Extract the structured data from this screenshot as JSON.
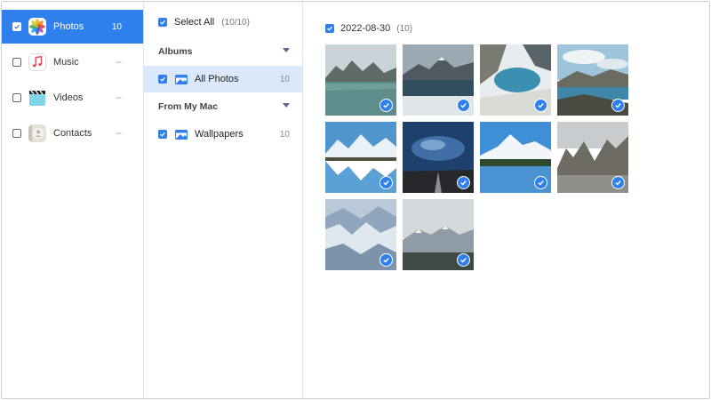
{
  "sidebar": {
    "items": [
      {
        "label": "Photos",
        "count": "10",
        "icon": "photos-app-icon",
        "checked": true,
        "active": true
      },
      {
        "label": "Music",
        "count": "--",
        "icon": "music-app-icon",
        "checked": false,
        "active": false
      },
      {
        "label": "Videos",
        "count": "--",
        "icon": "videos-app-icon",
        "checked": false,
        "active": false
      },
      {
        "label": "Contacts",
        "count": "--",
        "icon": "contacts-app-icon",
        "checked": false,
        "active": false
      }
    ]
  },
  "albums_panel": {
    "select_all": {
      "label": "Select All",
      "count": "(10/10)",
      "checked": true
    },
    "sections": [
      {
        "title": "Albums",
        "items": [
          {
            "label": "All Photos",
            "count": "10",
            "checked": true,
            "active": true
          }
        ]
      },
      {
        "title": "From My Mac",
        "items": [
          {
            "label": "Wallpapers",
            "count": "10",
            "checked": true,
            "active": false
          }
        ]
      }
    ]
  },
  "photos": {
    "date_group": {
      "date": "2022-08-30",
      "count": "(10)",
      "checked": true
    },
    "items": [
      {
        "checked": true
      },
      {
        "checked": true
      },
      {
        "checked": true
      },
      {
        "checked": true
      },
      {
        "checked": true
      },
      {
        "checked": true
      },
      {
        "checked": true
      },
      {
        "checked": true
      },
      {
        "checked": true
      },
      {
        "checked": true
      }
    ]
  },
  "colors": {
    "accent": "#2f80ed",
    "selected_row": "#dbe8f9",
    "border": "#e3e3e3"
  }
}
